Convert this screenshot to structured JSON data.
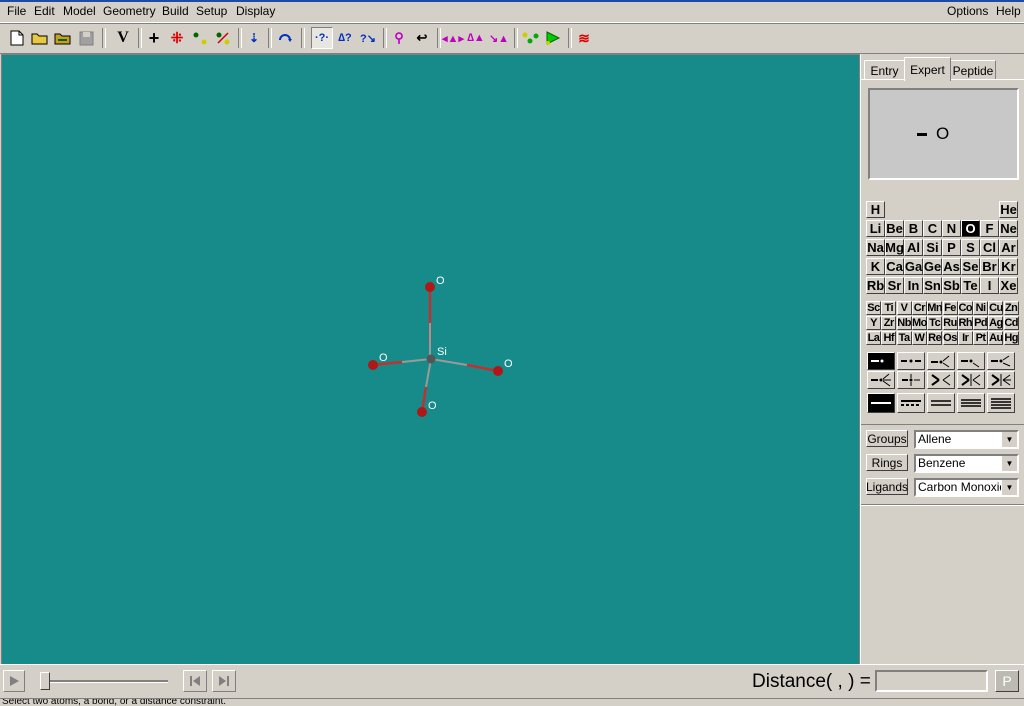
{
  "menu": {
    "left": [
      "File",
      "Edit",
      "Model",
      "Geometry",
      "Build",
      "Setup",
      "Display"
    ],
    "right": [
      "Options",
      "Help"
    ]
  },
  "toolbar": {
    "icons": [
      "new-file-icon",
      "open-folder-icon",
      "open-recent-icon",
      "save-icon",
      "view-icon",
      "add-fragment-icon",
      "delete-icon",
      "make-bond-icon",
      "break-bond-icon",
      "minimize-icon",
      "rotate-icon",
      "query-atom-icon",
      "query-angle-icon",
      "query-dihedral-icon",
      "symmetry-icon",
      "undo-icon",
      "measure-distance-icon",
      "measure-angle-icon",
      "measure-dihedral-icon",
      "constrain-icon",
      "calculate-icon",
      "surface-icon"
    ]
  },
  "molecule": {
    "center_label": "Si",
    "atom_labels": [
      "O",
      "O",
      "O",
      "O"
    ],
    "colors": {
      "background": "#178a8a",
      "oxygen": "#b01818",
      "silicon": "#555555",
      "bond_top": "#bf2a2a",
      "label": "#ffffff"
    }
  },
  "panel": {
    "tabs": [
      "Entry",
      "Expert",
      "Peptide"
    ],
    "active_tab": "Expert",
    "preview_label": "O",
    "elements_main": [
      [
        "H",
        "",
        "",
        "",
        "",
        "",
        "",
        "He"
      ],
      [
        "Li",
        "Be",
        "B",
        "C",
        "N",
        "O",
        "F",
        "Ne"
      ],
      [
        "Na",
        "Mg",
        "Al",
        "Si",
        "P",
        "S",
        "Cl",
        "Ar"
      ],
      [
        "K",
        "Ca",
        "Ga",
        "Ge",
        "As",
        "Se",
        "Br",
        "Kr"
      ],
      [
        "Rb",
        "Sr",
        "In",
        "Sn",
        "Sb",
        "Te",
        "I",
        "Xe"
      ]
    ],
    "elements_transition": [
      [
        "Sc",
        "Ti",
        "V",
        "Cr",
        "Mn",
        "Fe",
        "Co",
        "Ni",
        "Cu",
        "Zn"
      ],
      [
        "Y",
        "Zr",
        "Nb",
        "Mo",
        "Tc",
        "Ru",
        "Rh",
        "Pd",
        "Ag",
        "Cd"
      ],
      [
        "La",
        "Hf",
        "Ta",
        "W",
        "Re",
        "Os",
        "Ir",
        "Pt",
        "Au",
        "Hg"
      ]
    ],
    "selected_element": "O",
    "groups_label": "Groups",
    "groups_value": "Allene",
    "rings_label": "Rings",
    "rings_value": "Benzene",
    "ligands_label": "Ligands",
    "ligands_value": "Carbon Monoxide"
  },
  "bottom": {
    "distance_label": "Distance( , ) =",
    "distance_value": "",
    "p_button": "P",
    "status_text": "Select two atoms, a bond, or a distance constraint."
  }
}
